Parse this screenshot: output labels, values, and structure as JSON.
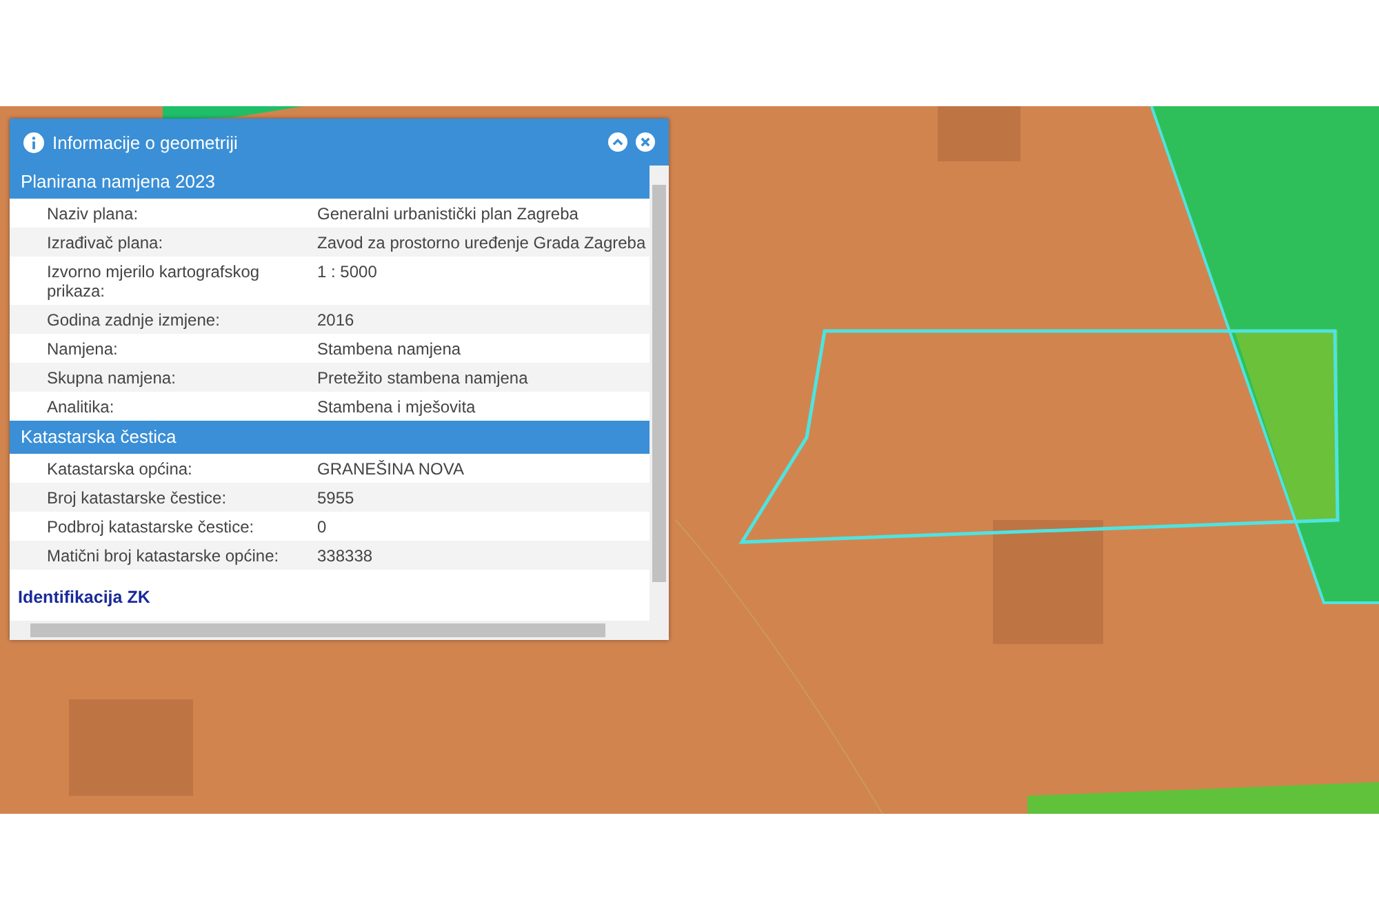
{
  "panel": {
    "title": "Informacije o geometriji"
  },
  "sections": [
    {
      "title": "Planirana namjena 2023",
      "expanded": true,
      "rows": [
        {
          "label": "Naziv plana:",
          "value": "Generalni urbanistički plan Zagreba"
        },
        {
          "label": "Izrađivač plana:",
          "value": "Zavod za prostorno uređenje Grada Zagreba"
        },
        {
          "label": "Izvorno mjerilo kartografskog prikaza:",
          "value": "1 : 5000"
        },
        {
          "label": "Godina zadnje izmjene:",
          "value": "2016"
        },
        {
          "label": "Namjena:",
          "value": "Stambena namjena"
        },
        {
          "label": "Skupna namjena:",
          "value": "Pretežito stambena namjena"
        },
        {
          "label": "Analitika:",
          "value": "Stambena i mješovita"
        }
      ]
    },
    {
      "title": "Katastarska čestica",
      "expanded": true,
      "rows": [
        {
          "label": "Katastarska općina:",
          "value": "GRANEŠINA NOVA"
        },
        {
          "label": "Broj katastarske čestice:",
          "value": "5955"
        },
        {
          "label": "Podbroj katastarske čestice:",
          "value": "0"
        },
        {
          "label": "Matični broj katastarske općine:",
          "value": "338338"
        }
      ]
    },
    {
      "title": "Identifikacija ZK",
      "expanded": false
    }
  ]
}
